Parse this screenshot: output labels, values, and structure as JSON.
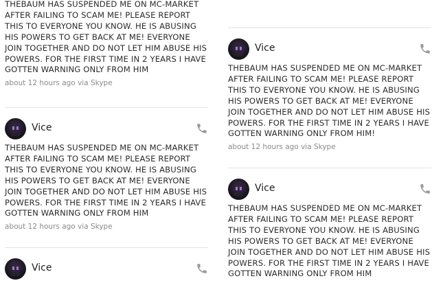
{
  "posts": [
    {
      "text": "THEBAUM HAS SUSPENDED ME ON MC-MARKET AFTER FAILING TO SCAM ME! PLEASE REPORT THIS TO EVERYONE YOU KNOW. HE IS ABUSING HIS POWERS TO GET BACK AT ME! EVERYONE JOIN TOGETHER AND DO NOT LET HIM ABUSE HIS POWERS. FOR THE FIRST TIME IN 2 YEARS I HAVE GOTTEN WARNING ONLY FROM HIM",
      "time": "about 12 hours ago",
      "via": "via Skype"
    },
    {
      "author": "Vice",
      "text": "THEBAUM HAS SUSPENDED ME ON MC-MARKET AFTER FAILING TO SCAM ME! PLEASE REPORT THIS TO EVERYONE YOU KNOW. HE IS ABUSING HIS POWERS TO GET BACK AT ME! EVERYONE JOIN TOGETHER AND DO NOT LET HIM ABUSE HIS POWERS. FOR THE FIRST TIME IN 2 YEARS I HAVE GOTTEN WARNING ONLY FROM HIM",
      "time": "about 12 hours ago",
      "via": "via Skype"
    },
    {
      "author": "Vice"
    },
    {
      "author": "Vice",
      "text": "THEBAUM HAS SUSPENDED ME ON MC-MARKET AFTER FAILING TO SCAM ME! PLEASE REPORT THIS TO EVERYONE YOU KNOW. HE IS ABUSING HIS POWERS TO GET BACK AT ME! EVERYONE JOIN TOGETHER AND DO NOT LET HIM ABUSE HIS POWERS. FOR THE FIRST TIME IN 2 YEARS I HAVE GOTTEN WARNING ONLY FROM HIM!",
      "time": "about 12 hours ago",
      "via": "via Skype"
    },
    {
      "author": "Vice",
      "text": "THEBAUM HAS SUSPENDED ME ON MC-MARKET AFTER FAILING TO SCAM ME! PLEASE REPORT THIS TO EVERYONE YOU KNOW. HE IS ABUSING HIS POWERS TO GET BACK AT ME! EVERYONE JOIN TOGETHER AND DO NOT LET HIM ABUSE HIS POWERS. FOR THE FIRST TIME IN 2 YEARS I HAVE GOTTEN WARNING ONLY FROM HIM"
    }
  ],
  "icons": {
    "call": "phone-icon",
    "avatar": "enderman-avatar"
  },
  "colors": {
    "meta": "#8a8a8a",
    "divider": "#e4e4e4",
    "avatar_eye": "#b06cf0"
  }
}
